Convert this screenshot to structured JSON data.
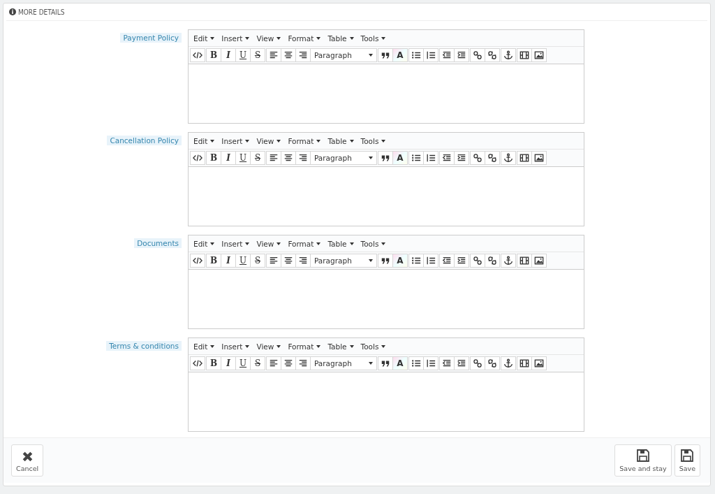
{
  "panel": {
    "title": "MORE DETAILS"
  },
  "fields": [
    {
      "label": "Payment Policy",
      "menus": [
        "Edit",
        "Insert",
        "View",
        "Format",
        "Table",
        "Tools"
      ],
      "format_buttons": [
        "B",
        "I",
        "U",
        "S"
      ],
      "block_format": "Paragraph",
      "color_button": "A"
    },
    {
      "label": "Cancellation Policy",
      "menus": [
        "Edit",
        "Insert",
        "View",
        "Format",
        "Table",
        "Tools"
      ],
      "format_buttons": [
        "B",
        "I",
        "U",
        "S"
      ],
      "block_format": "Paragraph",
      "color_button": "A"
    },
    {
      "label": "Documents",
      "menus": [
        "Edit",
        "Insert",
        "View",
        "Format",
        "Table",
        "Tools"
      ],
      "format_buttons": [
        "B",
        "I",
        "U",
        "S"
      ],
      "block_format": "Paragraph",
      "color_button": "A"
    },
    {
      "label": "Terms & conditions",
      "menus": [
        "Edit",
        "Insert",
        "View",
        "Format",
        "Table",
        "Tools"
      ],
      "format_buttons": [
        "B",
        "I",
        "U",
        "S"
      ],
      "block_format": "Paragraph",
      "color_button": "A"
    }
  ],
  "footer": {
    "cancel": "Cancel",
    "save_and_stay": "Save and stay",
    "save": "Save"
  }
}
